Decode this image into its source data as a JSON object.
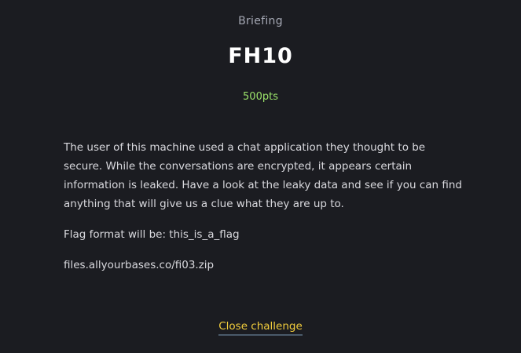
{
  "challenge": {
    "category": "Briefing",
    "title": "FH10",
    "points": "500pts",
    "description": "The user of this machine used a chat application they thought to be secure. While the conversations are encrypted, it appears certain information is leaked. Have a look at the leaky data and see if you can find anything that will give us a clue what they are up to.",
    "flag_format": "Flag format will be: this_is_a_flag",
    "file_link": "files.allyourbases.co/fi03.zip",
    "close_label": "Close challenge"
  },
  "colors": {
    "background": "#1b1c21",
    "points": "#9be36a",
    "close_button": "#f2cd3c"
  }
}
